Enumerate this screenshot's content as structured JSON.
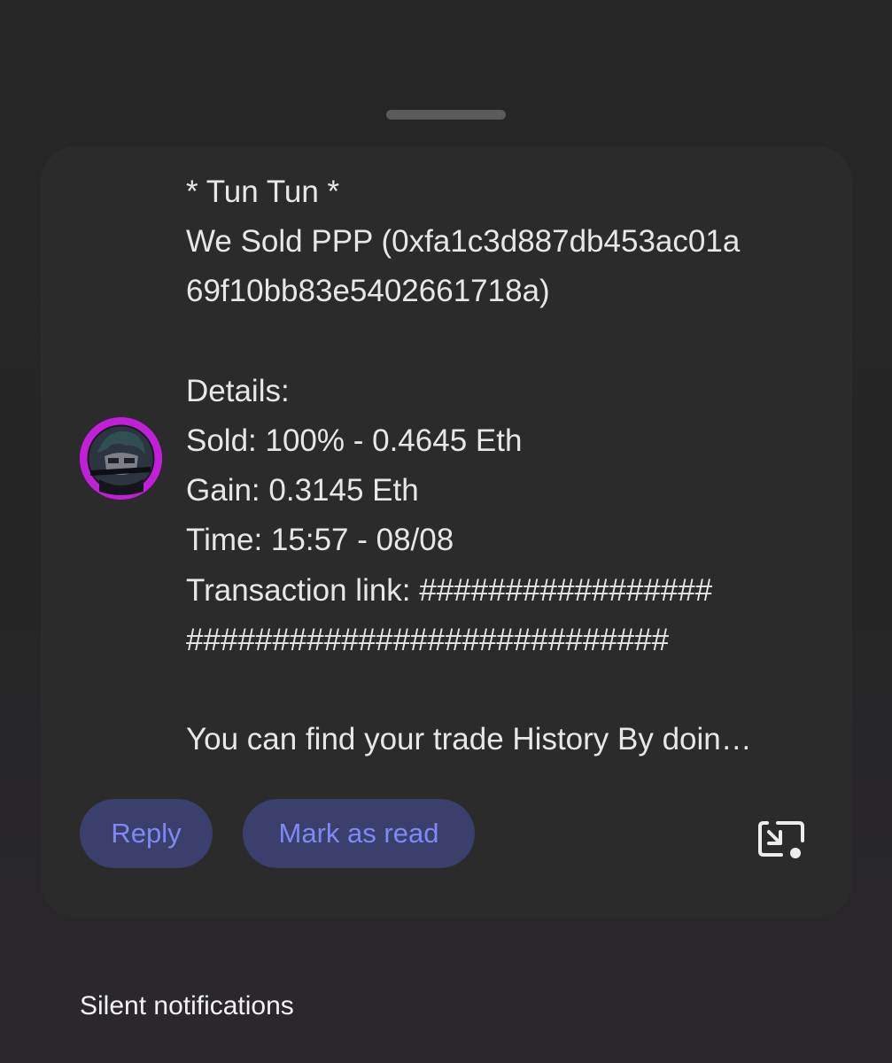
{
  "notification": {
    "lines": [
      "* Tun Tun *",
      "We Sold PPP (0xfa1c3d887db453ac01a",
      "69f10bb83e5402661718a)",
      "",
      "Details:",
      "Sold: 100% - 0.4645 Eth",
      "Gain: 0.3145 Eth",
      "Time: 15:57 - 08/08",
      "Transaction link: #################",
      "############################",
      "",
      "You can find your trade History By doin…"
    ],
    "avatar_icon": "bot-avatar-icon",
    "actions": {
      "reply_label": "Reply",
      "mark_read_label": "Mark as read"
    },
    "popout_icon": "popout-window-icon"
  },
  "section": {
    "silent_title": "Silent notifications"
  },
  "colors": {
    "accent_text": "#7d8af4",
    "pill_bg": "#3a3f6b",
    "card_bg": "#2b2b2c",
    "avatar_ring": "#c21fd8"
  }
}
